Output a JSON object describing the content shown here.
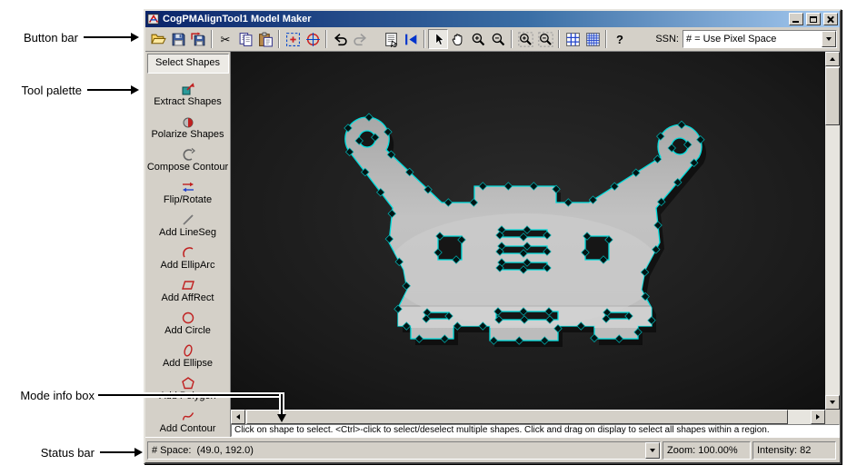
{
  "annotations": {
    "button_bar": "Button bar",
    "tool_palette": "Tool palette",
    "mode_info_box": "Mode info box",
    "status_bar": "Status bar"
  },
  "window": {
    "title": "CogPMAlignTool1 Model Maker"
  },
  "toolbar": {
    "ssn_label": "SSN:",
    "combo_value": "# = Use Pixel Space",
    "glyphs": {
      "cut": "✂",
      "help": "?"
    }
  },
  "palette": {
    "items": [
      {
        "label": "Select Shapes",
        "selected": true
      },
      {
        "label": "Extract Shapes"
      },
      {
        "label": "Polarize Shapes"
      },
      {
        "label": "Compose Contour"
      },
      {
        "label": "Flip/Rotate"
      },
      {
        "label": "Add LineSeg"
      },
      {
        "label": "Add EllipArc"
      },
      {
        "label": "Add AffRect"
      },
      {
        "label": "Add Circle"
      },
      {
        "label": "Add Ellipse"
      },
      {
        "label": "Add Polygon"
      },
      {
        "label": "Add Contour"
      }
    ]
  },
  "display": {
    "contour_color": "#00dede",
    "background": "#151515"
  },
  "mode_info": {
    "text": "Click on shape to select. <Ctrl>-click to select/deselect multiple shapes. Click and drag on display to select all shapes within a region."
  },
  "status_bar": {
    "space": "# Space:  (49.0, 192.0)",
    "zoom": "Zoom: 100.00%",
    "intensity": "Intensity: 82"
  }
}
